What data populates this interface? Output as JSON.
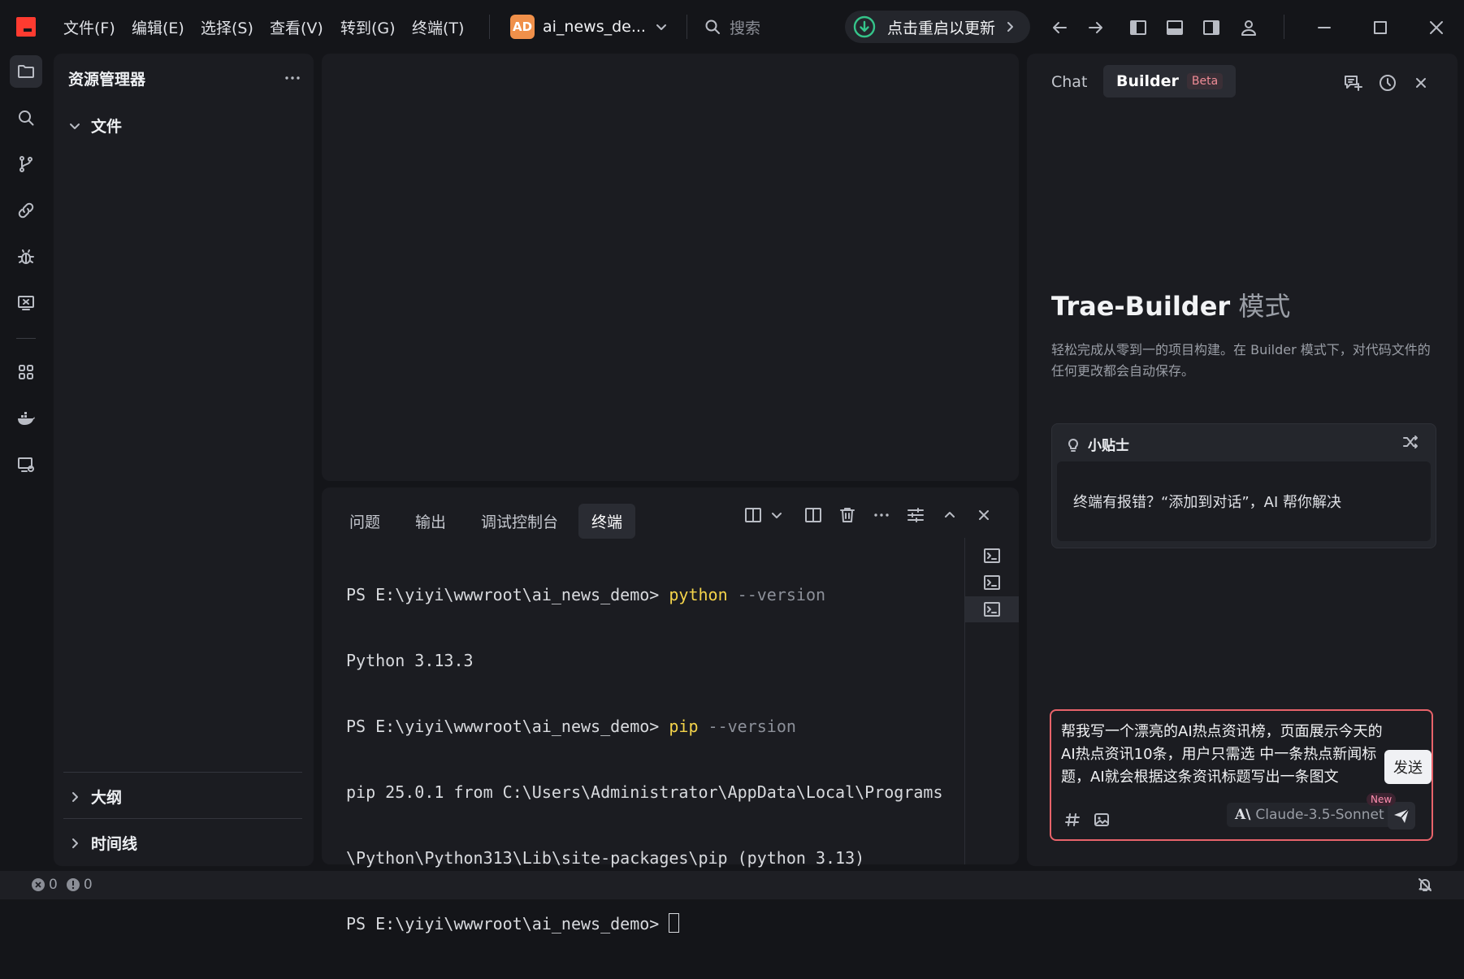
{
  "titlebar": {
    "menus": [
      "文件(F)",
      "编辑(E)",
      "选择(S)",
      "查看(V)",
      "转到(G)",
      "终端(T)"
    ],
    "project_badge": "AD",
    "project_name": "ai_news_de...",
    "search_placeholder": "搜索",
    "update_label": "点击重启以更新",
    "accent_logo": "#ff3b30"
  },
  "explorer": {
    "title": "资源管理器",
    "section_files": "文件",
    "section_outline": "大纲",
    "section_timeline": "时间线"
  },
  "panel": {
    "tabs": [
      "问题",
      "输出",
      "调试控制台",
      "终端"
    ],
    "active_tab": "终端",
    "terminal_lines": [
      {
        "prompt": "PS E:\\yiyi\\wwwroot\\ai_news_demo> ",
        "cmd": "python",
        "arg": " --version"
      },
      {
        "text": "Python 3.13.3"
      },
      {
        "prompt": "PS E:\\yiyi\\wwwroot\\ai_news_demo> ",
        "cmd": "pip",
        "arg": " --version"
      },
      {
        "text": "pip 25.0.1 from C:\\Users\\Administrator\\AppData\\Local\\Programs"
      },
      {
        "text": "\\Python\\Python313\\Lib\\site-packages\\pip (python 3.13)"
      },
      {
        "prompt": "PS E:\\yiyi\\wwwroot\\ai_news_demo> "
      }
    ]
  },
  "right": {
    "tab_chat": "Chat",
    "tab_builder": "Builder",
    "beta_badge": "Beta",
    "heading_main": "Trae-Builder",
    "heading_suffix": "模式",
    "description": "轻松完成从零到一的项目构建。在 Builder 模式下，对代码文件的任何更改都会自动保存。",
    "tips_title": "小贴士",
    "tips_text": "终端有报错？“添加到对话”，AI 帮你解决",
    "input_text": "帮我写一个漂亮的AI热点资讯榜，页面展示今天的AI热点资讯10条，用户只需选 中一条热点新闻标题，AI就会根据这条资讯标题写出一条图文",
    "send_tooltip": "发送",
    "new_badge": "New",
    "model_name": "Claude-3.5-Sonnet",
    "accent_border": "#e8636a"
  },
  "status": {
    "errors": "0",
    "warnings": "0"
  }
}
